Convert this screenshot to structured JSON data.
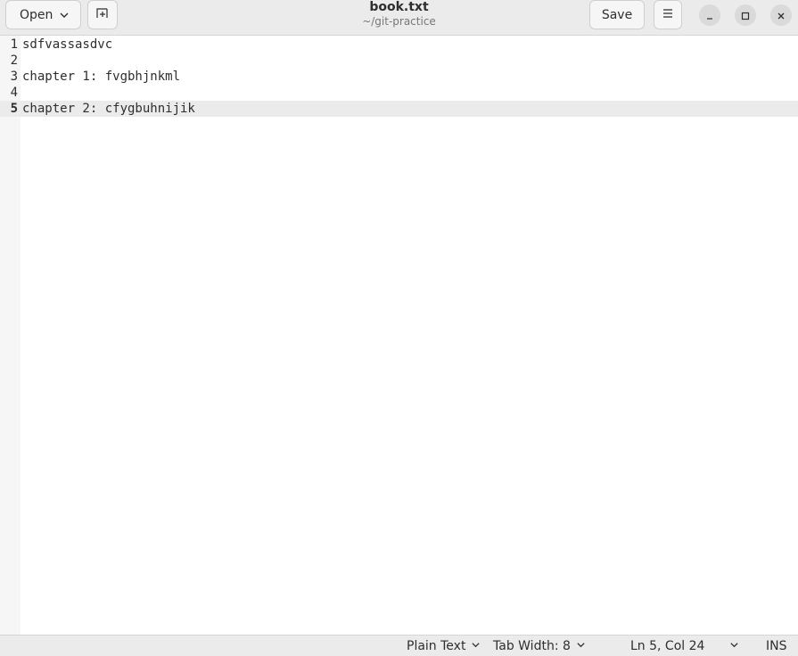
{
  "header": {
    "open_label": "Open",
    "new_tab_icon": "new-tab-icon",
    "title": "book.txt",
    "subtitle": "~/git-practice",
    "save_label": "Save",
    "menu_icon": "hamburger-menu-icon",
    "window_controls": [
      "minimize-icon",
      "maximize-icon",
      "close-icon"
    ]
  },
  "editor": {
    "current_line": 5,
    "lines": [
      {
        "number": "1",
        "text": "sdfvassasdvc"
      },
      {
        "number": "2",
        "text": ""
      },
      {
        "number": "3",
        "text": "chapter 1: fvgbhjnkml"
      },
      {
        "number": "4",
        "text": ""
      },
      {
        "number": "5",
        "text": "chapter 2: cfygbuhnijik"
      }
    ]
  },
  "statusbar": {
    "language": "Plain Text",
    "tab_width": "Tab Width: 8",
    "position": "Ln 5, Col 24",
    "mode": "INS"
  },
  "colors": {
    "headerbar_bg": "#ebebeb",
    "current_line_bg": "#ebebeb",
    "gutter_bg": "#f6f6f6",
    "text": "#2e2e2e"
  }
}
